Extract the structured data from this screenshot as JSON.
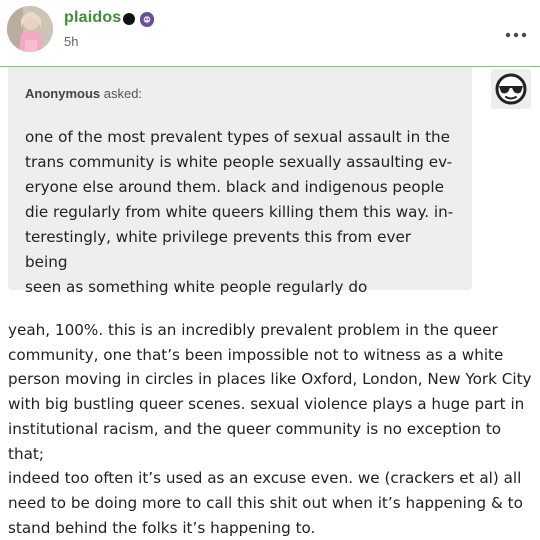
{
  "post": {
    "username": "plaidos",
    "timestamp": "5h",
    "badges": [
      "black-circle-badge",
      "purple-skull-badge"
    ],
    "more_icon": "more-horizontal-icon"
  },
  "ask": {
    "asker_name": "Anonymous",
    "asked_label": " asked:",
    "question_text": "one of the most prevalent types of sexual assault in the\ntrans community is white people sexually assaulting ev-\neryone else around them. black and indigenous people\ndie regularly from white queers killing them this way. in-\nterestingly, white privilege prevents this from ever being\nseen as something white people regularly do",
    "asker_icon": "sunglasses-face-icon"
  },
  "answer": {
    "text": "yeah, 100%. this is an incredibly prevalent problem in the queer\ncommunity, one that’s been impossible not to witness as a white\nperson moving in circles in places like Oxford, London, New York City\nwith big bustling queer scenes. sexual violence plays a huge part in\ninstitutional racism, and the queer community is no exception to that;\nindeed too often it’s used as an excuse even. we (crackers et al) all\nneed to be doing more   to call this shit out when it’s happening & to\nstand behind the folks it’s happening to."
  },
  "colors": {
    "username": "#3f8f37",
    "divider": "#84c870",
    "ask_background": "#eeeeee"
  }
}
